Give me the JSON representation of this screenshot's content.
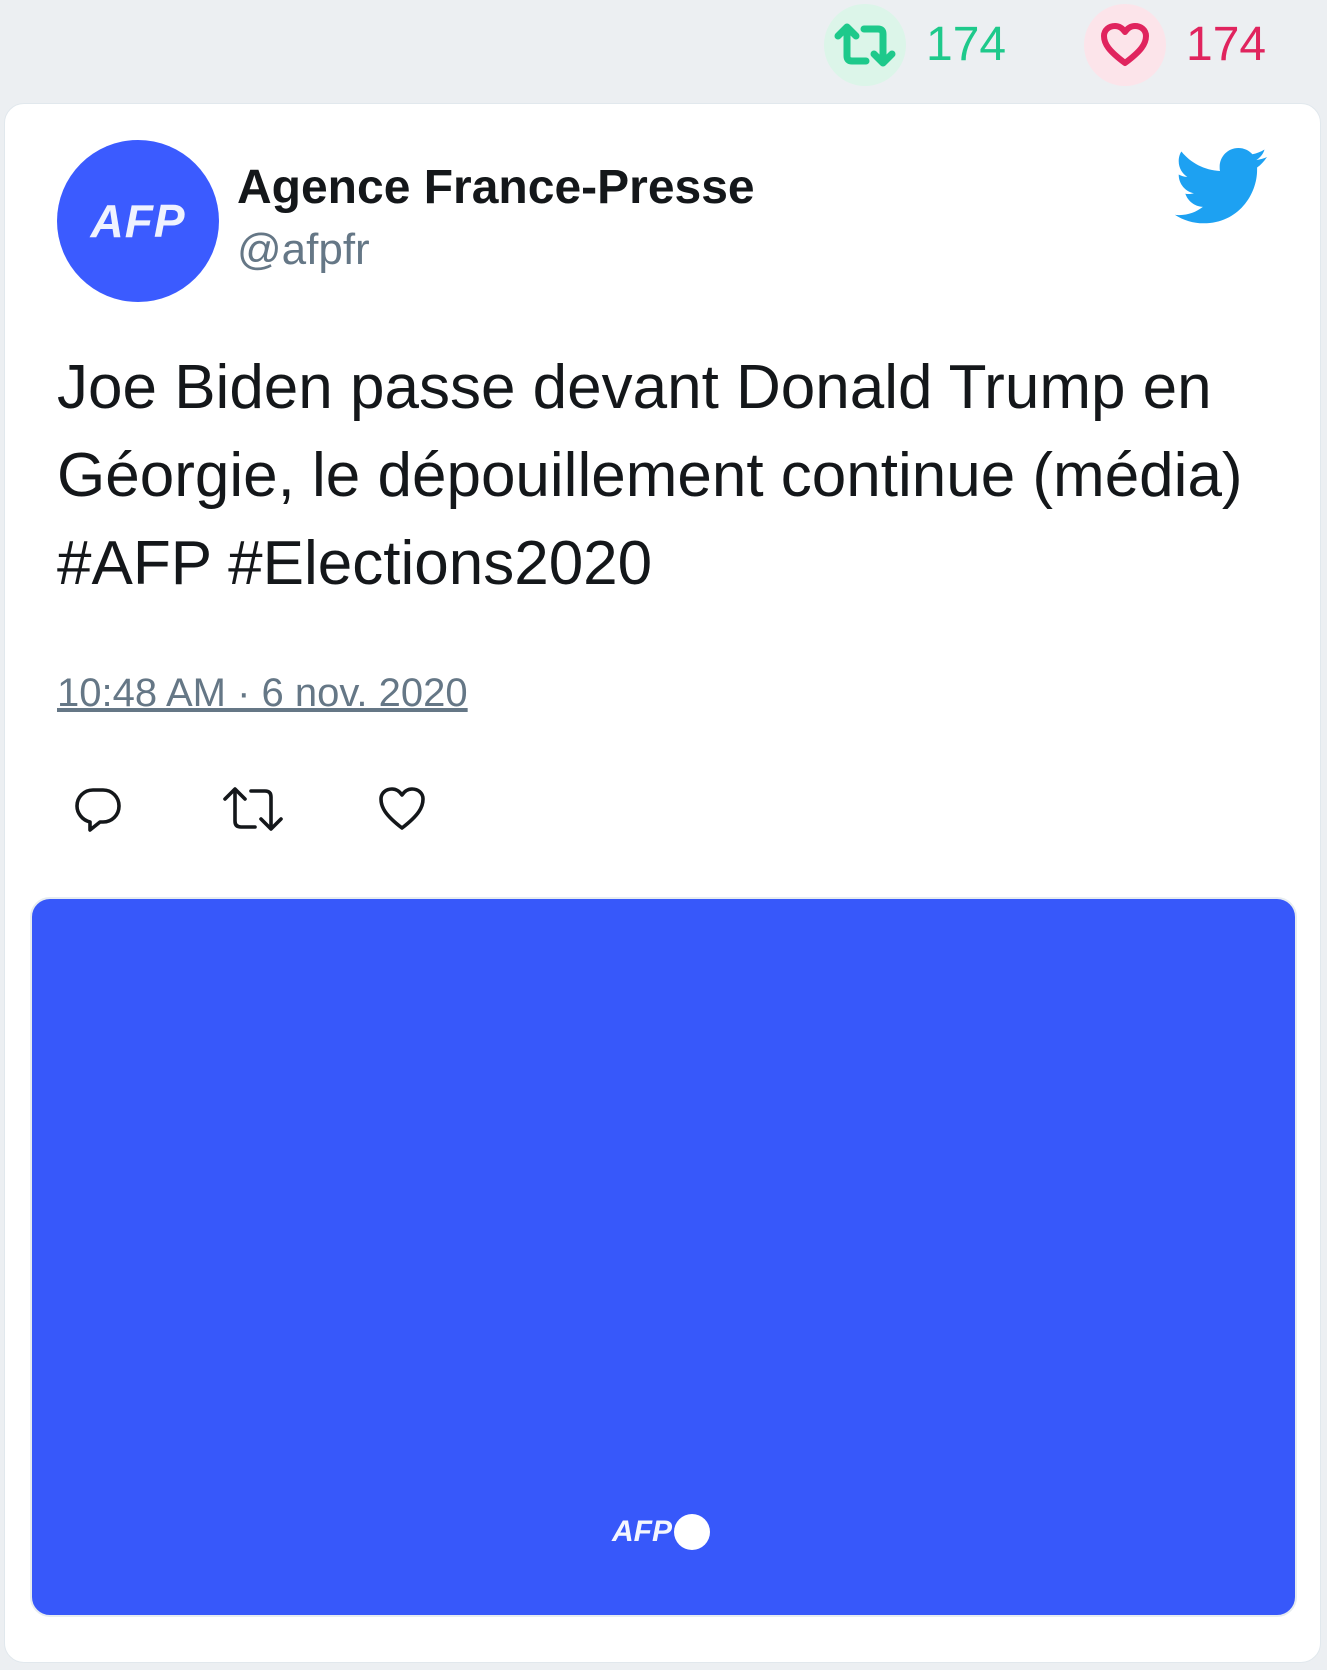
{
  "stats": {
    "retweets": "174",
    "likes": "174",
    "colors": {
      "retweet": "#1ec98b",
      "like": "#e0245e"
    }
  },
  "tweet": {
    "author_name": "Agence France-Presse",
    "author_handle": "@afpfr",
    "avatar_text": "AFP",
    "text": "Joe Biden passe devant Donald Trump en Géorgie, le dépouillement continue (média) #AFP #Elections2020",
    "timestamp": "10:48 AM · 6 nov. 2020",
    "actions": [
      "reply-icon",
      "retweet-icon",
      "like-icon"
    ]
  },
  "media": {
    "logo_text": "AFP",
    "background": "#3758fa"
  },
  "brand": {
    "twitter_blue": "#1da1f2",
    "afp_blue": "#3b5bff"
  }
}
